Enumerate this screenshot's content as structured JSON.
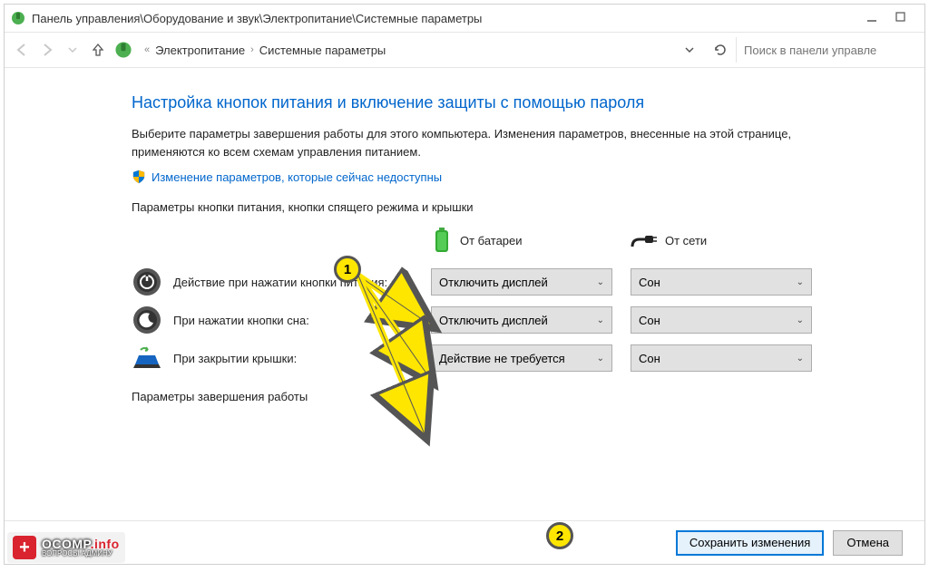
{
  "titlebar": {
    "text": "Панель управления\\Оборудование и звук\\Электропитание\\Системные параметры"
  },
  "breadcrumb": {
    "level1": "Электропитание",
    "level2": "Системные параметры"
  },
  "search": {
    "placeholder": "Поиск в панели управле"
  },
  "heading": "Настройка кнопок питания и включение защиты с помощью пароля",
  "description": "Выберите параметры завершения работы для этого компьютера. Изменения параметров, внесенные на этой странице, применяются ко всем схемам управления питанием.",
  "uac_link": "Изменение параметров, которые сейчас недоступны",
  "section1": "Параметры кнопки питания, кнопки спящего режима и крышки",
  "columns": {
    "battery": "От батареи",
    "plugged": "От сети"
  },
  "rows": [
    {
      "label": "Действие при нажатии кнопки питания:",
      "battery": "Отключить дисплей",
      "plugged": "Сон"
    },
    {
      "label": "При нажатии кнопки сна:",
      "battery": "Отключить дисплей",
      "plugged": "Сон"
    },
    {
      "label": "При закрытии крышки:",
      "battery": "Действие не требуется",
      "plugged": "Сон"
    }
  ],
  "section2": "Параметры завершения работы",
  "buttons": {
    "save": "Сохранить изменения",
    "cancel": "Отмена"
  },
  "annotations": {
    "badge1": "1",
    "badge2": "2"
  },
  "watermark": {
    "brand": "OCOMP",
    "tld": ".info",
    "tagline": "ВОПРОСЫ АДМИНУ"
  }
}
